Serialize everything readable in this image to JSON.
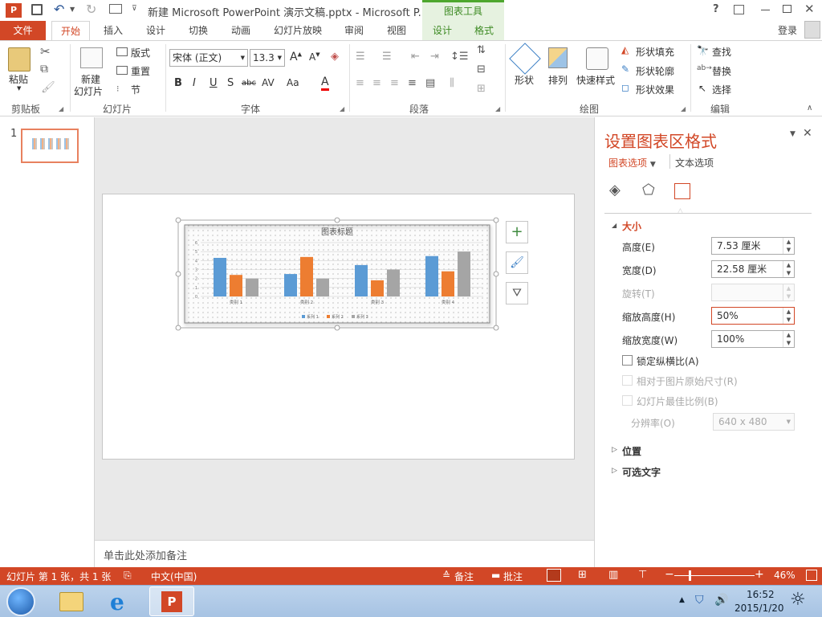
{
  "titlebar": {
    "title": "新建 Microsoft PowerPoint 演示文稿.pptx - Microsoft P...",
    "context_tools": "图表工具",
    "help": "?",
    "login": "登录"
  },
  "tabs": [
    "文件",
    "开始",
    "插入",
    "设计",
    "切换",
    "动画",
    "幻灯片放映",
    "审阅",
    "视图",
    "设计",
    "格式"
  ],
  "ribbon": {
    "paste": "粘贴",
    "new_slide_1": "新建",
    "new_slide_2": "幻灯片",
    "layout": "版式",
    "reset": "重置",
    "section": "节",
    "font_name": "宋体 (正文)",
    "font_size": "13.3",
    "shapes": "形状",
    "arrange": "排列",
    "quick_styles": "快速样式",
    "shape_fill": "形状填充",
    "shape_outline": "形状轮廓",
    "shape_effects": "形状效果",
    "find": "查找",
    "replace": "替换",
    "select": "选择",
    "groups": {
      "clipboard": "剪贴板",
      "slides": "幻灯片",
      "font": "字体",
      "paragraph": "段落",
      "drawing": "绘图",
      "editing": "编辑"
    }
  },
  "thumb": {
    "number": "1"
  },
  "chart_data": {
    "type": "bar",
    "title": "图表标题",
    "categories": [
      "类别 1",
      "类别 2",
      "类别 3",
      "类别 4"
    ],
    "series": [
      {
        "name": "系列 1",
        "values": [
          4.3,
          2.5,
          3.5,
          4.5
        ],
        "color": "#5b9bd5"
      },
      {
        "name": "系列 2",
        "values": [
          2.4,
          4.4,
          1.8,
          2.8
        ],
        "color": "#ed7d31"
      },
      {
        "name": "系列 3",
        "values": [
          2.0,
          2.0,
          3.0,
          5.0
        ],
        "color": "#a5a5a5"
      }
    ],
    "ylim": [
      0,
      6
    ],
    "y_ticks": [
      "0",
      "1",
      "2",
      "3",
      "4",
      "5",
      "6"
    ],
    "legend": "bottom",
    "grid": true
  },
  "notes": {
    "placeholder": "单击此处添加备注"
  },
  "pane": {
    "title": "设置图表区格式",
    "tab_chart": "图表选项",
    "tab_text": "文本选项",
    "section_size": "大小",
    "height_label": "高度(E)",
    "height_value": "7.53 厘米",
    "width_label": "宽度(D)",
    "width_value": "22.58 厘米",
    "rotate_label": "旋转(T)",
    "scale_h_label": "缩放高度(H)",
    "scale_h_value": "50%",
    "scale_w_label": "缩放宽度(W)",
    "scale_w_value": "100%",
    "lock_ratio": "锁定纵横比(A)",
    "relative_original": "相对于图片原始尺寸(R)",
    "best_scale": "幻灯片最佳比例(B)",
    "resolution_label": "分辨率(O)",
    "resolution_value": "640 x 480",
    "section_position": "位置",
    "section_alt": "可选文字"
  },
  "status": {
    "slide_info": "幻灯片 第 1 张，共 1 张",
    "language": "中文(中国)",
    "notes": "备注",
    "comments": "批注",
    "zoom": "46%"
  },
  "taskbar": {
    "time": "16:52",
    "date": "2015/1/20"
  },
  "colors": {
    "accent": "#d24726",
    "context_green": "#4ea72e"
  }
}
